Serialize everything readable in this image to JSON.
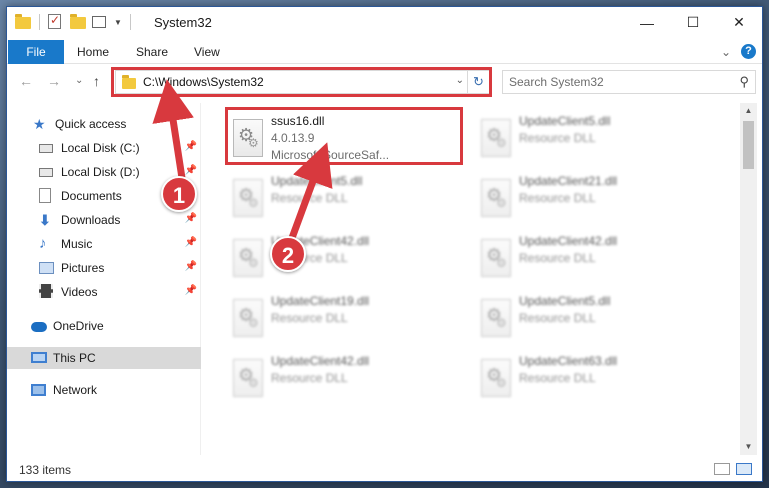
{
  "window": {
    "title": "System32",
    "controls": {
      "minimize": "—",
      "maximize": "☐",
      "close": "✕"
    }
  },
  "ribbon": {
    "tabs": [
      "File",
      "Home",
      "Share",
      "View"
    ],
    "expand_glyph": "⌄",
    "help_glyph": "?"
  },
  "nav": {
    "back": "←",
    "forward": "→",
    "recent": "⌄",
    "up": "↑",
    "address": "C:\\Windows\\System32",
    "address_dropdown": "⌄",
    "refresh": "↻",
    "search_placeholder": "Search System32",
    "search_icon": "⚲"
  },
  "sidebar": {
    "items": [
      {
        "label": "Quick access",
        "icon": "star-icon",
        "pinned": false
      },
      {
        "label": "Local Disk (C:)",
        "icon": "drive-icon",
        "pinned": true
      },
      {
        "label": "Local Disk (D:)",
        "icon": "drive-icon",
        "pinned": true
      },
      {
        "label": "Documents",
        "icon": "document-icon",
        "pinned": true
      },
      {
        "label": "Downloads",
        "icon": "download-icon",
        "pinned": true
      },
      {
        "label": "Music",
        "icon": "music-icon",
        "pinned": true
      },
      {
        "label": "Pictures",
        "icon": "pictures-icon",
        "pinned": true
      },
      {
        "label": "Videos",
        "icon": "videos-icon",
        "pinned": true
      },
      {
        "label": "OneDrive",
        "icon": "cloud-icon",
        "pinned": false
      },
      {
        "label": "This PC",
        "icon": "computer-icon",
        "pinned": false,
        "selected": true
      },
      {
        "label": "Network",
        "icon": "network-icon",
        "pinned": false
      }
    ],
    "pin_glyph": "📌"
  },
  "files": {
    "left": [
      {
        "name": "ssus16.dll",
        "line2": "4.0.13.9",
        "line3": "Microsoft SourceSaf..."
      },
      {
        "name": "UpdateClient5.dll",
        "line2": "Resource DLL"
      },
      {
        "name": "UpdateClient42.dll",
        "line2": "Resource DLL"
      },
      {
        "name": "UpdateClient19.dll",
        "line2": "Resource DLL"
      },
      {
        "name": "UpdateClient42.dll",
        "line2": "Resource DLL"
      }
    ],
    "right": [
      {
        "name": "UpdateClient5.dll",
        "line2": "Resource DLL"
      },
      {
        "name": "UpdateClient21.dll",
        "line2": "Resource DLL"
      },
      {
        "name": "UpdateClient42.dll",
        "line2": "Resource DLL"
      },
      {
        "name": "UpdateClient5.dll",
        "line2": "Resource DLL"
      },
      {
        "name": "UpdateClient63.dll",
        "line2": "Resource DLL"
      }
    ]
  },
  "status": {
    "item_count": "133 items"
  },
  "callouts": {
    "one": "1",
    "two": "2"
  },
  "colors": {
    "accent": "#1979ca",
    "highlight_red": "#d8393e"
  }
}
